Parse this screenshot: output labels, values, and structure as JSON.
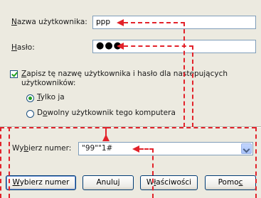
{
  "username": {
    "label": "Nazwa użytkownika:",
    "value": "ppp"
  },
  "password": {
    "label": "Hasło:",
    "value": "●●●"
  },
  "save_password": {
    "label_line1": "Zapisz tę nazwę użytkownika i hasło dla następujących",
    "label_line2": "użytkowników:",
    "checked": true
  },
  "scope_options": {
    "only_me": {
      "label": "Tylko ja",
      "selected": true
    },
    "anyone": {
      "label": "Dowolny użytkownik tego komputera",
      "selected": false
    }
  },
  "dial": {
    "label": "Wybierz numer:",
    "value": "\"99\"\"1#"
  },
  "buttons": {
    "dial": "Wybierz numer",
    "cancel": "Anuluj",
    "properties": "Właściwości",
    "help": "Pomoc"
  },
  "colors": {
    "annotation": "#e2222a",
    "checkmark": "#21a121",
    "background": "#eceae0"
  }
}
